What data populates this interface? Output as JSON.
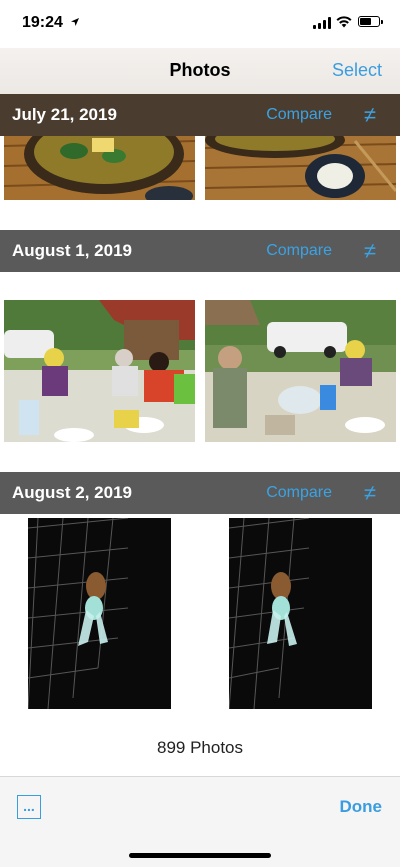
{
  "status": {
    "time": "19:24"
  },
  "nav": {
    "title": "Photos",
    "select_label": "Select"
  },
  "sections": [
    {
      "date": "July 21, 2019",
      "compare_label": "Compare",
      "neq_symbol": "≠"
    },
    {
      "date": "August 1, 2019",
      "compare_label": "Compare",
      "neq_symbol": "≠"
    },
    {
      "date": "August 2, 2019",
      "compare_label": "Compare",
      "neq_symbol": "≠"
    }
  ],
  "footer": {
    "count_text": "899 Photos"
  },
  "toolbar": {
    "more_label": "...",
    "done_label": "Done"
  },
  "colors": {
    "accent": "#3a9de0",
    "header_dark": "#4a3d30",
    "header_gray": "#5a5a5a"
  }
}
